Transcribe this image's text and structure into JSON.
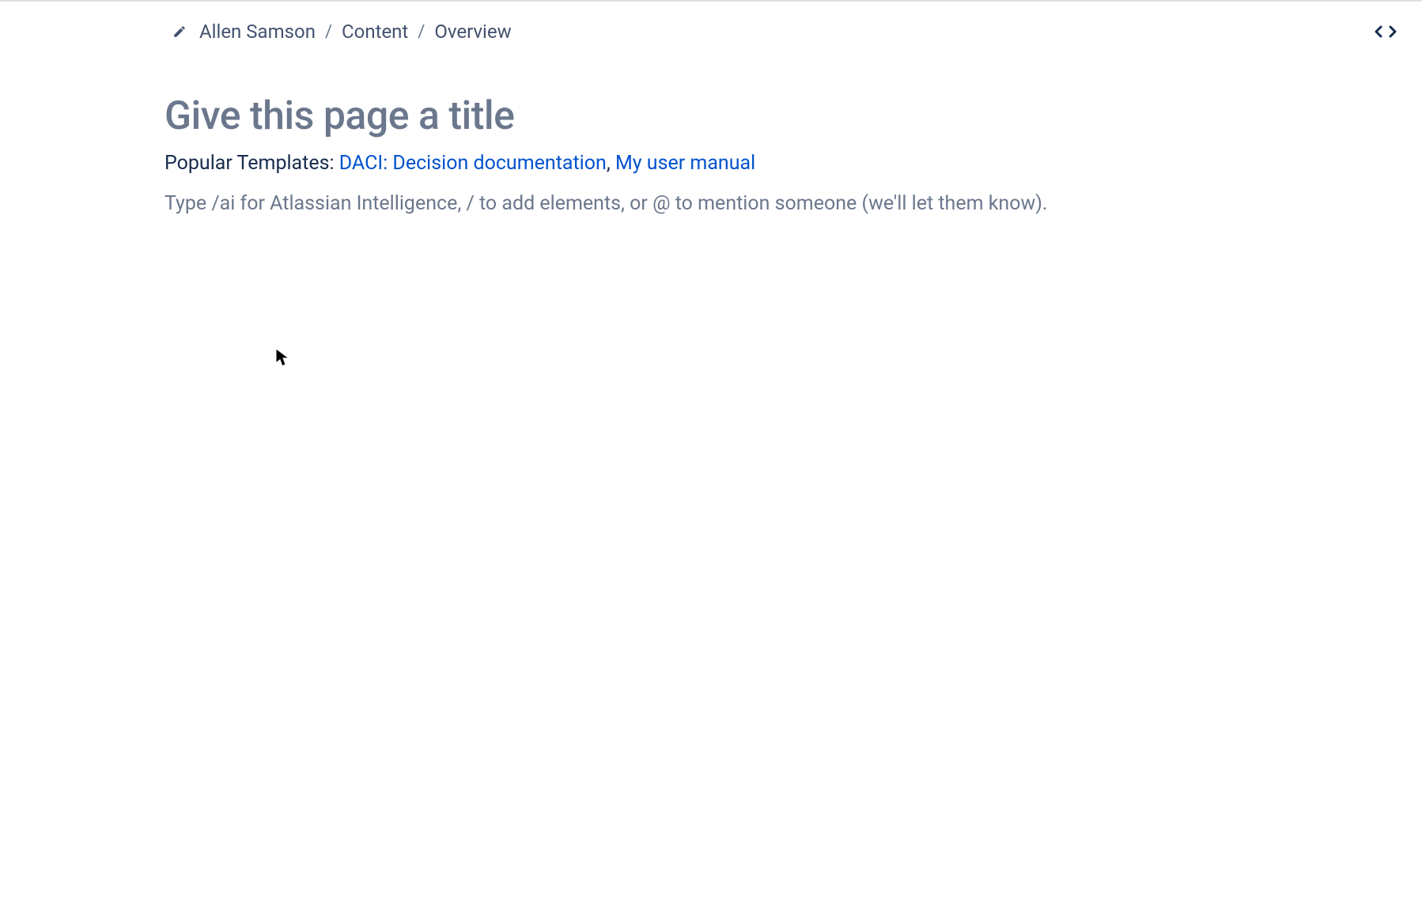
{
  "breadcrumb": {
    "items": [
      "Allen Samson",
      "Content",
      "Overview"
    ],
    "separator": "/"
  },
  "title": {
    "placeholder": "Give this page a title"
  },
  "templates": {
    "label": "Popular Templates: ",
    "links": [
      "DACI: Decision documentation",
      "My user manual"
    ],
    "separator": ", "
  },
  "body": {
    "hint": "Type /ai for Atlassian Intelligence, / to add elements, or @ to mention someone (we'll let them know)."
  }
}
